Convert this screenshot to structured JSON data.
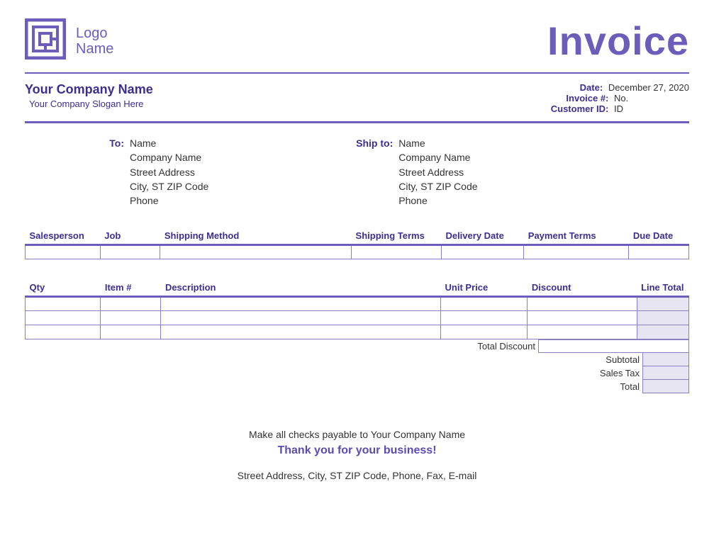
{
  "header": {
    "logo_text_line1": "Logo",
    "logo_text_line2": "Name",
    "title": "Invoice"
  },
  "company": {
    "name": "Your Company Name",
    "slogan": "Your Company Slogan Here"
  },
  "meta": {
    "date_label": "Date:",
    "date_value": "December 27, 2020",
    "invoice_label": "Invoice #:",
    "invoice_value": "No.",
    "customer_label": "Customer ID:",
    "customer_value": "ID"
  },
  "to": {
    "label": "To:",
    "name": "Name",
    "company": "Company Name",
    "street": "Street Address",
    "city": "City, ST  ZIP Code",
    "phone": "Phone"
  },
  "shipto": {
    "label": "Ship to:",
    "name": "Name",
    "company": "Company Name",
    "street": "Street Address",
    "city": "City, ST  ZIP Code",
    "phone": "Phone"
  },
  "terms_headers": {
    "salesperson": "Salesperson",
    "job": "Job",
    "shipping_method": "Shipping Method",
    "shipping_terms": "Shipping Terms",
    "delivery_date": "Delivery Date",
    "payment_terms": "Payment Terms",
    "due_date": "Due Date"
  },
  "items_headers": {
    "qty": "Qty",
    "item": "Item #",
    "description": "Description",
    "unit_price": "Unit Price",
    "discount": "Discount",
    "line_total": "Line Total"
  },
  "totals": {
    "total_discount": "Total Discount",
    "subtotal": "Subtotal",
    "sales_tax": "Sales Tax",
    "total": "Total"
  },
  "footer": {
    "payable": "Make all checks payable to Your Company Name",
    "thanks": "Thank you for your business!",
    "contact": "Street Address, City, ST  ZIP Code,  Phone,  Fax,  E-mail"
  }
}
